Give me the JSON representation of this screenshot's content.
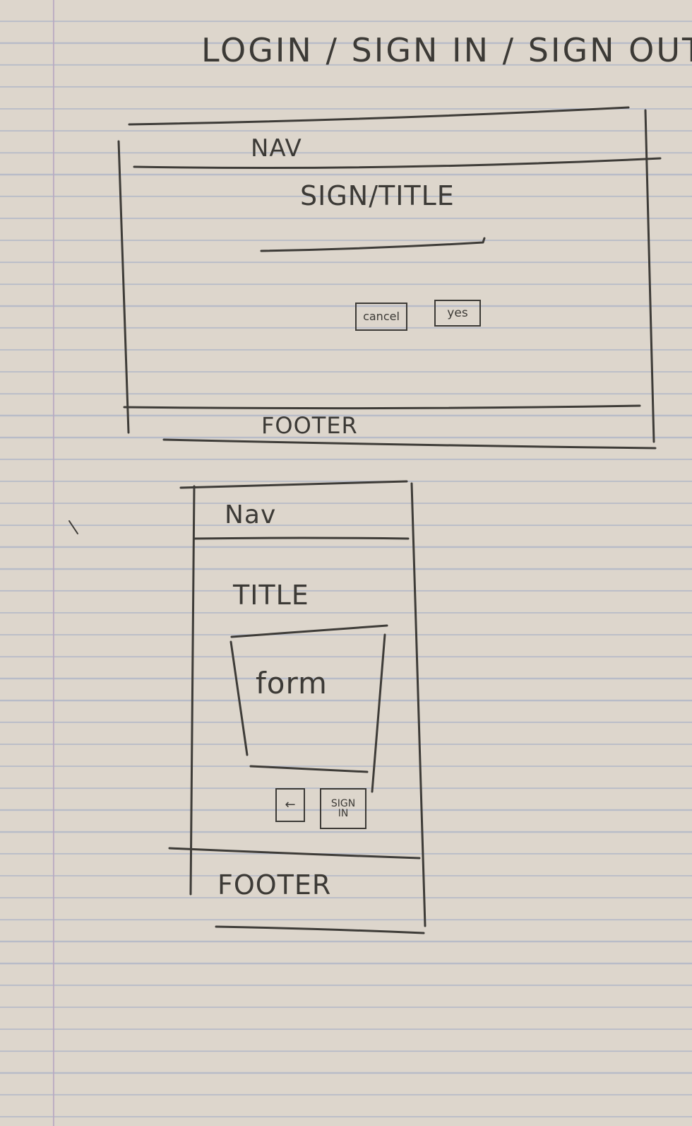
{
  "page_title": "LOGIN / SIGN IN / SIGN OUT",
  "desktop_wireframe": {
    "nav_label": "NAV",
    "title_label": "SIGN/TITLE",
    "cancel_label": "cancel",
    "yes_label": "yes",
    "footer_label": "FOOTER"
  },
  "mobile_wireframe": {
    "nav_label": "Nav",
    "title_label": "TITLE",
    "form_label": "form",
    "back_label": "←",
    "signin_label": "SIGN\nIN",
    "footer_label": "FOOTER"
  },
  "colors": {
    "paper": "#ddd6cc",
    "ruling": "#b8bcc8",
    "margin_line": "#b9a9c2",
    "pencil": "#3c3a36"
  }
}
